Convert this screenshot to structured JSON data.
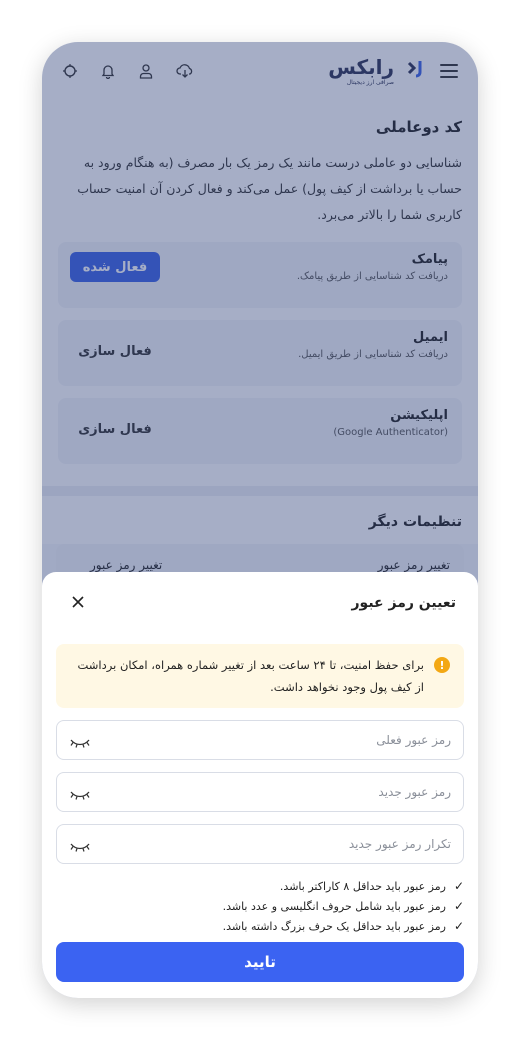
{
  "header": {
    "brand_name": "رابکس",
    "brand_sub": "صرافی ارز دیجیتال",
    "icons": [
      "menu-icon",
      "download-icon",
      "user-icon",
      "bell-icon",
      "theme-icon"
    ]
  },
  "two_factor": {
    "title": "کد دوعاملی",
    "description": "شناسایی دو عاملی درست مانند یک رمز یک بار مصرف (به هنگام ورود به حساب یا برداشت از کیف پول) عمل می‌کند و فعال کردن آن امنیت حساب کاربری شما را بالاتر می‌برد.",
    "options": [
      {
        "title": "پیامک",
        "desc": "دریافت کد شناسایی از طریق پیامک.",
        "button": "فعال شده",
        "active": true
      },
      {
        "title": "ایمیل",
        "desc": "دریافت کد شناسایی از طریق ایمیل.",
        "button": "فعال سازی",
        "active": false
      },
      {
        "title": "اپلیکیشن",
        "desc": "(Google Authenticator)",
        "button": "فعال سازی",
        "active": false
      }
    ]
  },
  "other_settings": {
    "title": "تنظیمات دیگر",
    "row_label": "تغییر رمز عبور",
    "row_action": "تغییر رمز عبور"
  },
  "modal": {
    "title": "تعیین رمز عبور",
    "alert": "برای حفظ امنیت، تا ۲۴ ساعت بعد از تغییر شماره همراه، امکان برداشت از کیف پول وجود نخواهد داشت.",
    "fields": {
      "current_placeholder": "رمز عبور فعلی",
      "new_placeholder": "رمز عبور جدید",
      "confirm_placeholder": "تکرار رمز عبور جدید"
    },
    "rules": [
      "رمز عبور باید حداقل ۸ کاراکتر باشد.",
      "رمز عبور باید شامل حروف انگلیسی و عدد باشد.",
      "رمز عبور باید حداقل یک حرف بزرگ داشته باشد."
    ],
    "submit": "تایید"
  },
  "colors": {
    "accent": "#3b63f2",
    "overlay": "#2a3f76",
    "alert_bg": "#fff8e4",
    "alert_icon": "#f3a814"
  }
}
